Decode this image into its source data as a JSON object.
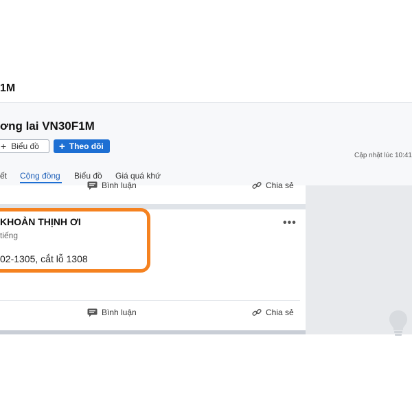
{
  "site": {
    "title": "1M"
  },
  "header": {
    "stock_title": "ơng lai VN30F1M",
    "chart_button_label": "Biểu đồ",
    "follow_button_label": "Theo dõi",
    "updated_text": "Cập nhật lúc  10:41"
  },
  "tabs": [
    {
      "label": "ết"
    },
    {
      "label": "Cộng đồng",
      "active": true
    },
    {
      "label": "Biểu đồ"
    },
    {
      "label": "Giá quá khứ"
    }
  ],
  "previous_post": {
    "comment_label": "Bình luận",
    "share_label": "Chia sẻ"
  },
  "post": {
    "author": "KHOẢN THỊNH ƠI",
    "meta": "tiếng",
    "text": "02-1305, cắt lỗ 1308",
    "more_label": "•••",
    "comment_label": "Bình luận",
    "share_label": "Chia sẻ"
  },
  "colors": {
    "accent": "#1d6fd3",
    "highlight": "#f58220"
  },
  "icons": [
    "plus-icon",
    "comment-icon",
    "link-icon",
    "lightbulb-icon",
    "more-icon"
  ]
}
